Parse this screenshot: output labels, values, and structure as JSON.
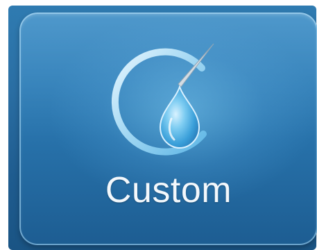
{
  "tile": {
    "label": "Custom",
    "icon": "custom-water-drop-icon",
    "colors": {
      "tile_top": "#3b8dc6",
      "tile_bottom": "#1d5d92",
      "ring": "#bfe4f6",
      "drop": "#6fc3ea",
      "label": "#f3f8fc"
    }
  }
}
